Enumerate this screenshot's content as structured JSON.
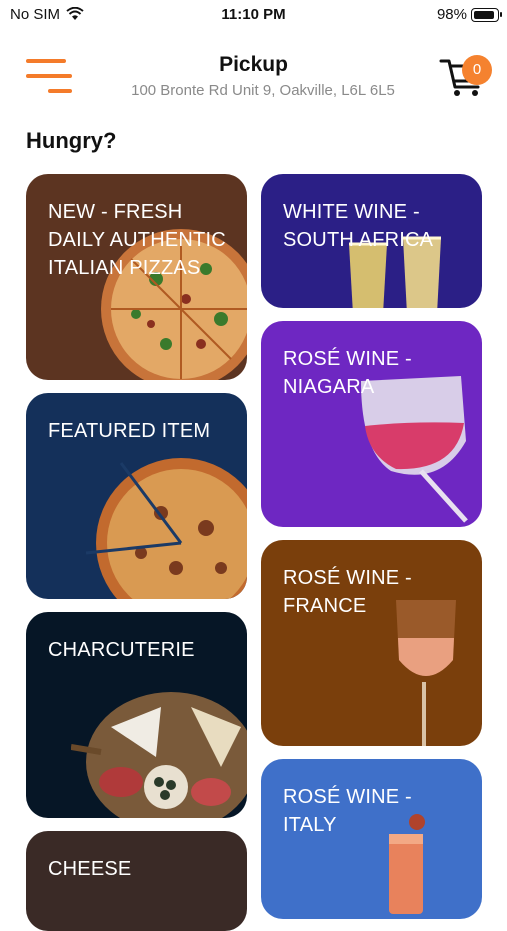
{
  "status": {
    "carrier": "No SIM",
    "time": "11:10 PM",
    "battery": "98%"
  },
  "header": {
    "title": "Pickup",
    "address": "100 Bronte Rd Unit 9, Oakville, L6L 6L5",
    "cart_count": "0"
  },
  "section_title": "Hungry?",
  "tiles": [
    {
      "label": "NEW - FRESH DAILY AUTHENTIC ITALIAN PIZZAS",
      "color": "#5c3421"
    },
    {
      "label": "WHITE WINE - SOUTH AFRICA",
      "color": "#2b1f86"
    },
    {
      "label": "ROSÉ WINE - NIAGARA",
      "color": "#6e27c2"
    },
    {
      "label": "FEATURED ITEM",
      "color": "#14305a"
    },
    {
      "label": "ROSÉ WINE - FRANCE",
      "color": "#7a3f0c"
    },
    {
      "label": "CHARCUTERIE",
      "color": "#061626"
    },
    {
      "label": "ROSÉ WINE - ITALY",
      "color": "#3f70c9"
    },
    {
      "label": "CHEESE",
      "color": "#3a2a26"
    }
  ],
  "accent": "#f47b2a"
}
